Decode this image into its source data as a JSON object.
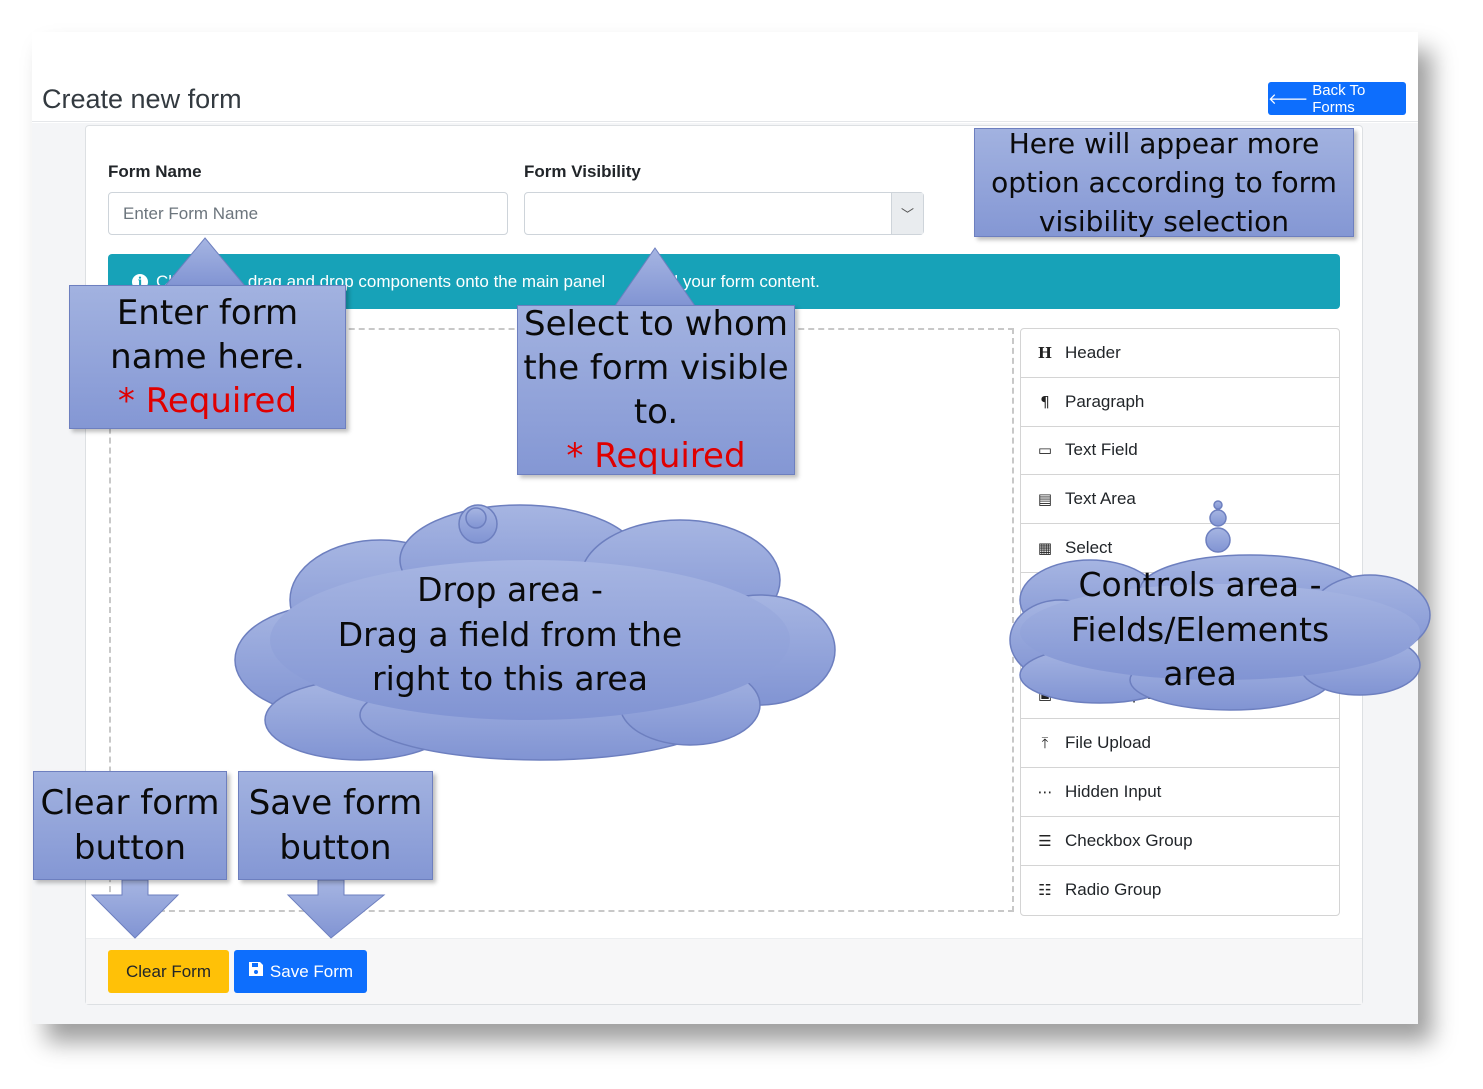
{
  "page": {
    "title": "Create new form",
    "back_button": "Back To Forms"
  },
  "form": {
    "name_label": "Form Name",
    "name_placeholder": "Enter Form Name",
    "visibility_label": "Form Visibility",
    "visibility_value": ""
  },
  "info": {
    "text_visible_1": "Cli",
    "text_visible_2": "drag and drop components onto the main panel",
    "text_visible_3": "ild your form content."
  },
  "controls": [
    {
      "label": "Header",
      "icon": "header-icon",
      "glyph": "H"
    },
    {
      "label": "Paragraph",
      "icon": "paragraph-icon",
      "glyph": "¶"
    },
    {
      "label": "Text Field",
      "icon": "text-field-icon",
      "glyph": "▭"
    },
    {
      "label": "Text Area",
      "icon": "text-area-icon",
      "glyph": "▤"
    },
    {
      "label": "Select",
      "icon": "select-icon",
      "glyph": "▦"
    },
    {
      "label": "",
      "icon": "number-icon",
      "glyph": "#"
    },
    {
      "label": "",
      "icon": "date-icon",
      "glyph": ""
    },
    {
      "label": "Autocomplete",
      "icon": "autocomplete-icon",
      "glyph": "▣"
    },
    {
      "label": "File Upload",
      "icon": "upload-icon",
      "glyph": "⤒"
    },
    {
      "label": "Hidden Input",
      "icon": "hidden-input-icon",
      "glyph": "⋯"
    },
    {
      "label": "Checkbox Group",
      "icon": "checkbox-group-icon",
      "glyph": "☰"
    },
    {
      "label": "Radio Group",
      "icon": "radio-group-icon",
      "glyph": "☷"
    }
  ],
  "footer": {
    "clear_button": "Clear Form",
    "save_button": "Save Form"
  },
  "annotations": {
    "visibility_note": "Here will appear more option according to form visibility selection",
    "name_note_line1": "Enter form",
    "name_note_line2": "name here.",
    "required": "* Required",
    "select_note_line1": "Select to whom",
    "select_note_line2": "the form visible",
    "select_note_line3": "to.",
    "drop_line1": "Drop area -",
    "drop_line2": "Drag a field from the",
    "drop_line3": "right to this area",
    "controls_line1": "Controls area -",
    "controls_line2": "Fields/Elements",
    "controls_line3": "area",
    "clear_note_line1": "Clear form",
    "clear_note_line2": "button",
    "save_note_line1": "Save form",
    "save_note_line2": "button"
  }
}
